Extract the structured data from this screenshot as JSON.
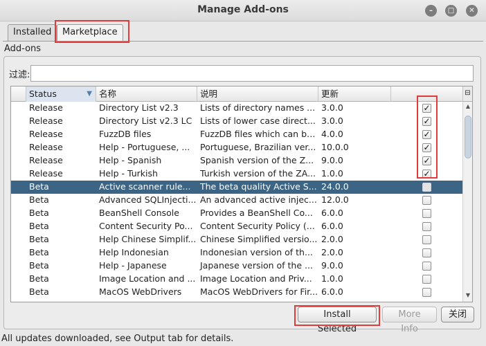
{
  "window": {
    "title": "Manage Add-ons"
  },
  "tabs": [
    {
      "label": "Installed"
    },
    {
      "label": "Marketplace"
    }
  ],
  "section_label": "Add-ons",
  "filter": {
    "label": "过滤:",
    "value": ""
  },
  "table": {
    "columns": [
      {
        "label": "Status"
      },
      {
        "label": "名称"
      },
      {
        "label": "说明"
      },
      {
        "label": "更新"
      }
    ],
    "rows": [
      {
        "status": "Release",
        "name": "Directory List v2.3",
        "desc": "Lists of directory names ...",
        "version": "3.0.0",
        "checked": true
      },
      {
        "status": "Release",
        "name": "Directory List v2.3 LC",
        "desc": "Lists of lower case direct...",
        "version": "3.0.0",
        "checked": true
      },
      {
        "status": "Release",
        "name": "FuzzDB files",
        "desc": "FuzzDB files which can be...",
        "version": "4.0.0",
        "checked": true
      },
      {
        "status": "Release",
        "name": "Help - Portuguese, ...",
        "desc": "Portuguese, Brazilian ver...",
        "version": "10.0.0",
        "checked": true
      },
      {
        "status": "Release",
        "name": "Help - Spanish",
        "desc": "Spanish version of the Z...",
        "version": "9.0.0",
        "checked": true
      },
      {
        "status": "Release",
        "name": "Help - Turkish",
        "desc": "Turkish version of the ZA...",
        "version": "1.0.0",
        "checked": true
      },
      {
        "status": "Beta",
        "name": "Active scanner rule...",
        "desc": "The beta quality Active S...",
        "version": "24.0.0",
        "checked": false,
        "selected": true
      },
      {
        "status": "Beta",
        "name": "Advanced SQLInjecti...",
        "desc": "An advanced active injec...",
        "version": "12.0.0",
        "checked": false
      },
      {
        "status": "Beta",
        "name": "BeanShell Console",
        "desc": "Provides a BeanShell Co...",
        "version": "6.0.0",
        "checked": false
      },
      {
        "status": "Beta",
        "name": "Content Security Po...",
        "desc": "Content Security Policy (...",
        "version": "6.0.0",
        "checked": false
      },
      {
        "status": "Beta",
        "name": "Help Chinese Simplif...",
        "desc": "Chinese Simplified versio...",
        "version": "2.0.0",
        "checked": false
      },
      {
        "status": "Beta",
        "name": "Help Indonesian",
        "desc": "Indonesian version of th...",
        "version": "2.0.0",
        "checked": false
      },
      {
        "status": "Beta",
        "name": "Help - Japanese",
        "desc": "Japanese version of the ...",
        "version": "9.0.0",
        "checked": false
      },
      {
        "status": "Beta",
        "name": "Image Location and ...",
        "desc": "Image Location and Priv...",
        "version": "1.0.0",
        "checked": false
      },
      {
        "status": "Beta",
        "name": "MacOS WebDrivers",
        "desc": "MacOS WebDrivers for Fir...",
        "version": "6.0.0",
        "checked": false
      }
    ]
  },
  "buttons": {
    "install": "Install Selected",
    "more_info": "More Info",
    "close": "关闭"
  },
  "status_bar": "All updates downloaded, see Output tab for details.",
  "icons": {
    "minimize": "minimize-icon",
    "maximize": "maximize-icon",
    "close": "close-icon",
    "sort": "sort-descending-icon",
    "column_chooser": "column-chooser-icon",
    "check": "checkmark-icon"
  },
  "colors": {
    "selection": "#3b6485",
    "highlight": "#e23a3a"
  }
}
